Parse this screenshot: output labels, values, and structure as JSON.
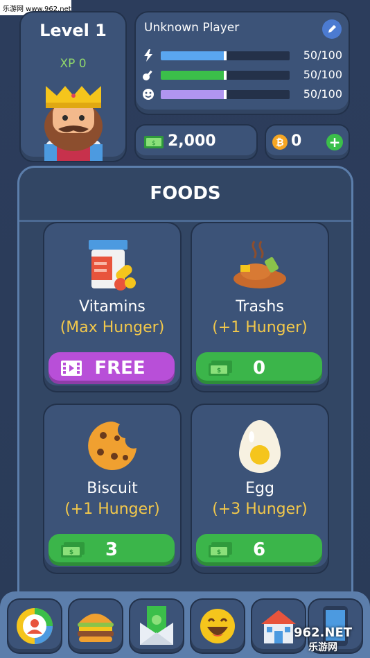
{
  "watermark": {
    "top_left": "乐游网 www.962.net",
    "bottom_right_main": "962.NET",
    "bottom_right_sub": "乐游网"
  },
  "profile": {
    "level": "Level 1",
    "xp": "XP 0"
  },
  "player": {
    "name": "Unknown Player",
    "stats": [
      {
        "icon": "lightning-icon",
        "value": "50/100",
        "fill": 0.5,
        "color": "#5aa6f0"
      },
      {
        "icon": "guitar-icon",
        "value": "50/100",
        "fill": 0.5,
        "color": "#3bbf4a"
      },
      {
        "icon": "smiley-icon",
        "value": "50/100",
        "fill": 0.5,
        "color": "#b095f0"
      }
    ]
  },
  "wallet": {
    "cash": "2,000",
    "coins": "0"
  },
  "foods": {
    "title": "FOODS",
    "items": [
      {
        "name": "Vitamins",
        "effect": "(Max Hunger)",
        "button": "FREE",
        "button_type": "video"
      },
      {
        "name": "Trashs",
        "effect": "(+1 Hunger)",
        "button": "0",
        "button_type": "cash"
      },
      {
        "name": "Biscuit",
        "effect": "(+1 Hunger)",
        "button": "3",
        "button_type": "cash"
      },
      {
        "name": "Egg",
        "effect": "(+3 Hunger)",
        "button": "6",
        "button_type": "cash"
      }
    ]
  },
  "nav": [
    "profile-icon",
    "burger-icon",
    "mail-money-icon",
    "emoji-icon",
    "house-icon",
    "phone-icon"
  ]
}
